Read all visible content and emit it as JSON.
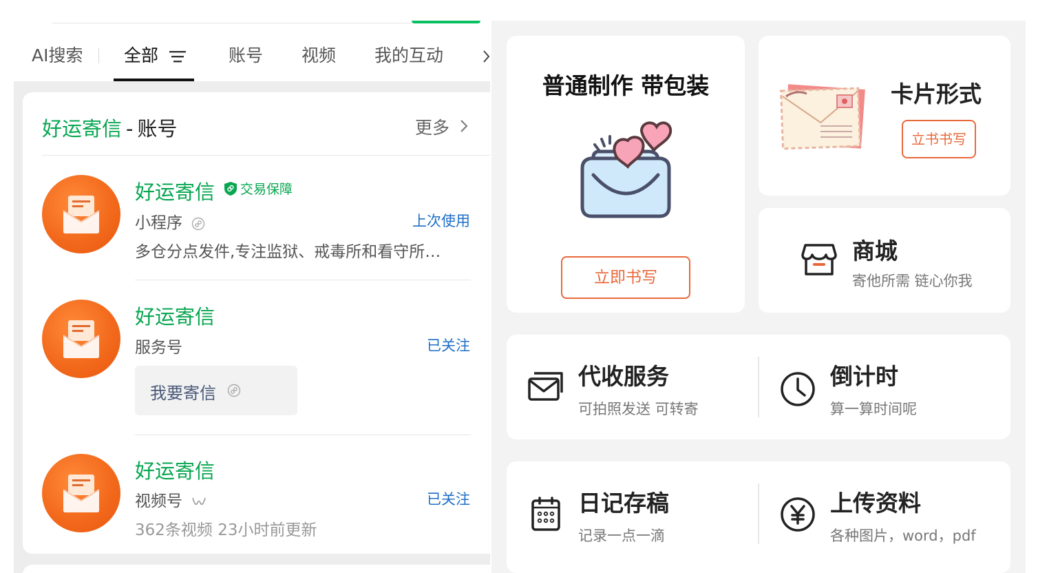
{
  "tabs": {
    "ai_search": "AI搜索",
    "all": "全部",
    "account": "账号",
    "video": "视频",
    "my_interactions": "我的互动"
  },
  "card": {
    "title_brand": "好运寄信",
    "title_dash": "-",
    "title_section": "账号",
    "more": "更多"
  },
  "results": [
    {
      "name": "好运寄信",
      "badge": "交易保障",
      "type": "小程序",
      "status": "上次使用",
      "description": "多仓分点发件,专注监狱、戒毒所和看守所…"
    },
    {
      "name": "好运寄信",
      "type": "服务号",
      "status": "已关注",
      "service_button": "我要寄信"
    },
    {
      "name": "好运寄信",
      "type": "视频号",
      "status": "已关注",
      "meta": "362条视频  23小时前更新"
    }
  ],
  "right": {
    "make": {
      "title": "普通制作 带包装",
      "button": "立即书写"
    },
    "postcard": {
      "title": "卡片形式",
      "button": "立书书写"
    },
    "shop": {
      "title": "商城",
      "subtitle": "寄他所需 链心你我"
    },
    "features": [
      {
        "title": "代收服务",
        "subtitle": "可拍照发送 可转寄",
        "icon": "envelope-icon"
      },
      {
        "title": "倒计时",
        "subtitle": "算一算时间呢",
        "icon": "clock-icon"
      },
      {
        "title": "日记存稿",
        "subtitle": "记录一点一滴",
        "icon": "calendar-icon"
      },
      {
        "title": "上传资料",
        "subtitle": "各种图片，word，pdf",
        "icon": "yuan-icon"
      }
    ]
  },
  "colors": {
    "brand_green": "#07a650",
    "link_blue": "#1e6ec8",
    "accent_orange": "#e8683a",
    "avatar_orange": "#f36a1c"
  }
}
